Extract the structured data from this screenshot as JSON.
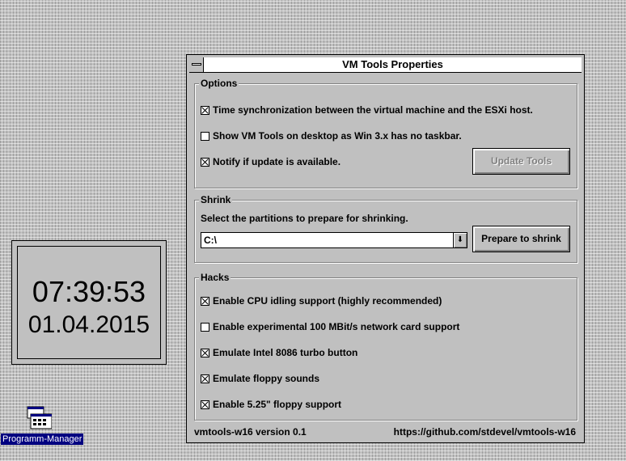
{
  "clock": {
    "time": "07:39:53",
    "date": "01.04.2015"
  },
  "desktop": {
    "program_manager_label": "Programm-Manager"
  },
  "window": {
    "title": "VM Tools Properties",
    "options": {
      "label": "Options",
      "time_sync": {
        "label": "Time synchronization between the virtual machine and the ESXi host.",
        "checked": true
      },
      "show_desktop": {
        "label": "Show VM Tools on desktop as Win 3.x has no taskbar.",
        "checked": false
      },
      "notify_update": {
        "label": "Notify if update is available.",
        "checked": true
      },
      "update_button": "Update Tools"
    },
    "shrink": {
      "label": "Shrink",
      "instruction": "Select the partitions to prepare for shrinking.",
      "partition_value": "C:\\",
      "prepare_button": "Prepare to shrink"
    },
    "hacks": {
      "label": "Hacks",
      "items": [
        {
          "label": "Enable CPU idling support (highly recommended)",
          "checked": true
        },
        {
          "label": "Enable experimental 100 MBit/s network card support",
          "checked": false
        },
        {
          "label": "Emulate Intel 8086 turbo button",
          "checked": true
        },
        {
          "label": "Emulate floppy sounds",
          "checked": true
        },
        {
          "label": "Enable 5.25\" floppy support",
          "checked": true
        }
      ]
    },
    "footer": {
      "version": "vmtools-w16 version 0.1",
      "url": "https://github.com/stdevel/vmtools-w16"
    }
  }
}
